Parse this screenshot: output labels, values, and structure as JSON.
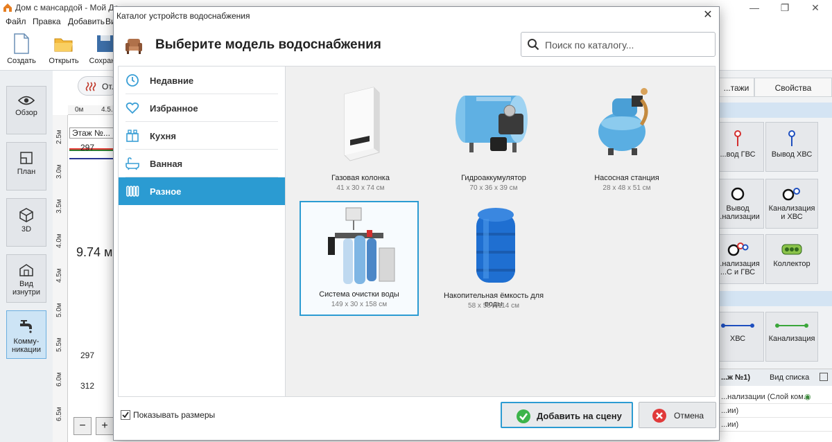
{
  "app": {
    "title": "Дом с мансардой - Мой До...",
    "menu": [
      "Файл",
      "Правка",
      "Добавить",
      "Ви..."
    ],
    "toolbar": [
      "Создать",
      "Открыть",
      "Сохран..."
    ],
    "side_buttons": [
      "Обзор",
      "План",
      "3D",
      "Вид изнутри",
      "Комму-никации"
    ],
    "canvas": {
      "tab_label": "От...",
      "ruler_top": [
        "0м",
        "4.5..."
      ],
      "ruler_left": [
        "2.5м",
        "3.0м",
        "3.5м",
        "4.0м",
        "4.5м",
        "5.0м",
        "5.5м",
        "6.0м",
        "6.5м"
      ],
      "floor_label": "Этаж №...",
      "values": [
        "297",
        "9.74 м",
        "297",
        "312"
      ]
    },
    "right_panel": {
      "tabs": [
        "...тажи",
        "Свойства"
      ],
      "tiles": [
        "...вод ГВС",
        "Вывод ХВС",
        "Вывод ...нализации",
        "Канализация и ХВС",
        "...нализация ...С и ГВС",
        "Коллектор",
        "ХВС",
        "Канализация"
      ],
      "list_header": "...ж №1)",
      "list_view_label": "Вид списка",
      "list_rows": [
        "...нализации (Слой ком...",
        "...ии)",
        "...ии)"
      ]
    }
  },
  "dialog": {
    "title": "Каталог устройств водоснабжения",
    "heading": "Выберите модель водоснабжения",
    "search_placeholder": "Поиск по каталогу...",
    "categories": [
      {
        "label": "Недавние",
        "icon": "clock-icon",
        "selected": false
      },
      {
        "label": "Избранное",
        "icon": "heart-icon",
        "selected": false
      },
      {
        "label": "Кухня",
        "icon": "kitchen-icon",
        "selected": false
      },
      {
        "label": "Ванная",
        "icon": "bathtub-icon",
        "selected": false
      },
      {
        "label": "Разное",
        "icon": "radiator-icon",
        "selected": true
      }
    ],
    "products": [
      {
        "name": "Газовая колонка",
        "size": "41 x 30 x 74 см"
      },
      {
        "name": "Гидроаккумулятор",
        "size": "70 x 36 x 39 см"
      },
      {
        "name": "Насосная станция",
        "size": "28 x 48 x 51 см"
      },
      {
        "name": "Система очистки воды",
        "size": "149 x 30 x 158 см"
      },
      {
        "name": "Накопительная ёмкость для воды",
        "size": "58 x 58 x 114 см"
      }
    ],
    "show_sizes_label": "Показывать размеры",
    "show_sizes_checked": true,
    "add_button": "Добавить на сцену",
    "cancel_button": "Отмена"
  },
  "colors": {
    "accent": "#2b9bd2",
    "ok_green": "#3cb44a",
    "cancel_red": "#e03a3a"
  }
}
